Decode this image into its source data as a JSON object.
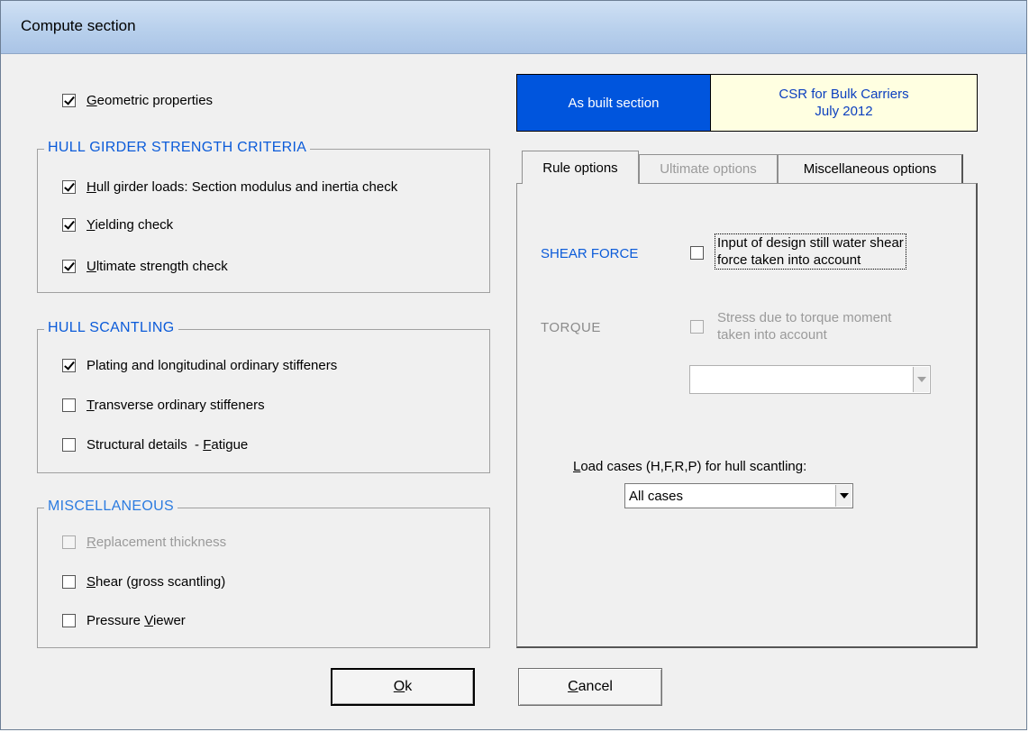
{
  "window": {
    "title": "Compute section"
  },
  "geometric": {
    "label_u": "G",
    "label_rest": "eometric properties",
    "checked": true
  },
  "hull_girder": {
    "legend": "HULL GIRDER STRENGTH CRITERIA",
    "items": [
      {
        "u": "H",
        "rest": "ull girder loads: Section modulus and inertia check",
        "checked": true
      },
      {
        "u": "Y",
        "rest": "ielding check",
        "checked": true
      },
      {
        "u": "U",
        "rest": "ltimate strength check",
        "checked": true
      }
    ]
  },
  "hull_scantling": {
    "legend": "HULL SCANTLING",
    "items": [
      {
        "u": "",
        "rest": "Plating and longitudinal ordinary stiffeners",
        "checked": true
      },
      {
        "u": "T",
        "rest": "ransverse ordinary stiffeners",
        "checked": false
      },
      {
        "pre": "Structural details  - ",
        "u": "F",
        "rest": "atigue",
        "checked": false
      }
    ]
  },
  "miscellaneous": {
    "legend": "MISCELLANEOUS",
    "items": [
      {
        "u": "R",
        "rest": "eplacement thickness",
        "checked": false,
        "disabled": true
      },
      {
        "u": "S",
        "rest": "hear (gross scantling)",
        "checked": false
      },
      {
        "pre": "Pressure ",
        "u": "V",
        "rest": "iewer",
        "checked": false
      }
    ]
  },
  "mode": {
    "as_built": "As built section",
    "rule_line1": "CSR for Bulk Carriers",
    "rule_line2": "July 2012",
    "as_built_color": "#0055dd",
    "rule_bg": "#ffffe1"
  },
  "tabs": {
    "rule": "Rule options",
    "ultimate": "Ultimate options",
    "misc": "Miscellaneous options"
  },
  "shear_force": {
    "heading": "SHEAR FORCE",
    "line1": "Input of design still water shear",
    "line2": "force taken into account",
    "checked": false
  },
  "torque": {
    "heading": "TORQUE",
    "line1": "Stress due to torque moment",
    "line2": "taken into account",
    "checked": false,
    "disabled": true,
    "combo_value": ""
  },
  "load_cases": {
    "label_u": "L",
    "label_rest": "oad cases (H,F,R,P) for hull scantling:",
    "selected": "All cases"
  },
  "buttons": {
    "ok_u": "O",
    "ok_rest": "k",
    "cancel_u": "C",
    "cancel_rest": "ancel"
  }
}
